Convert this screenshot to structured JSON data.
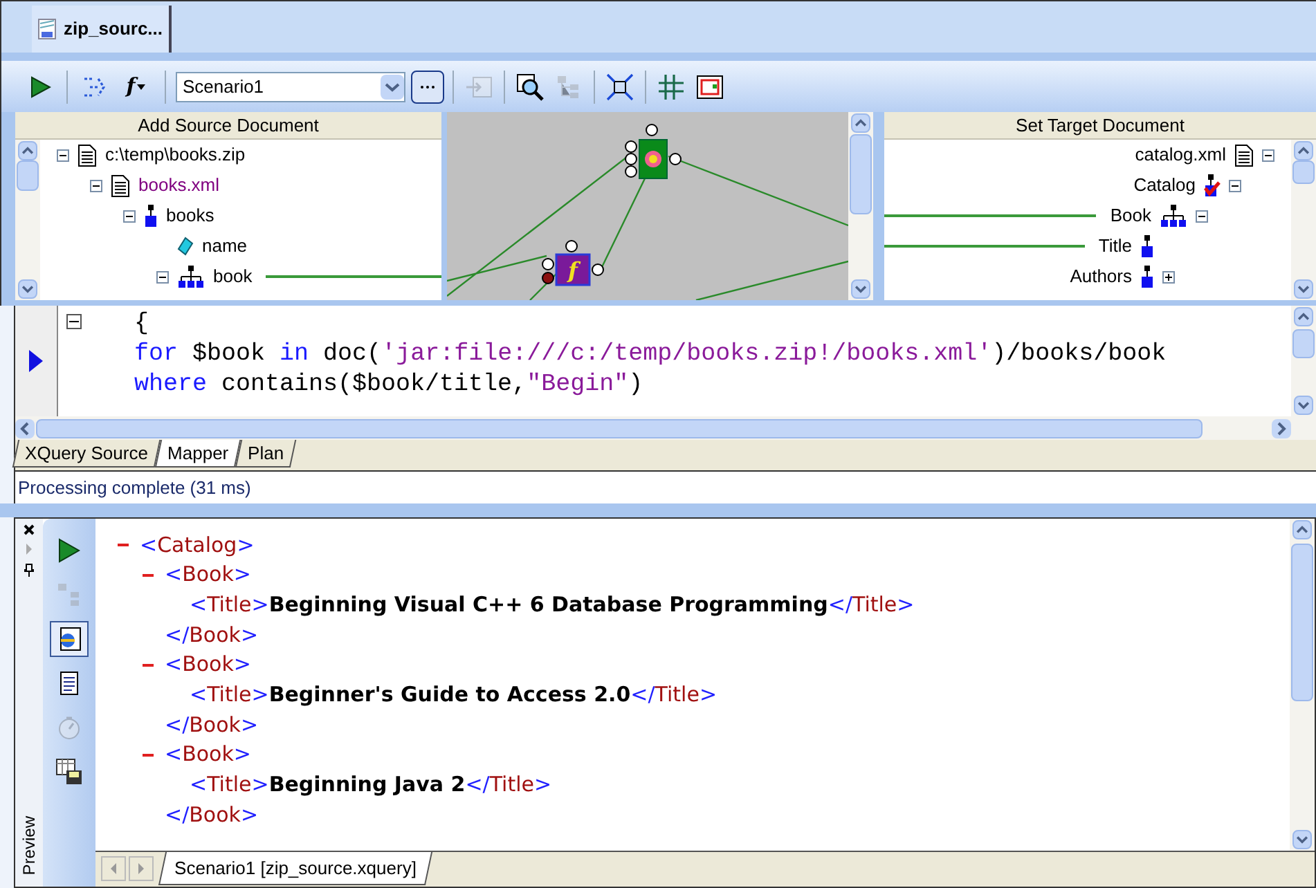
{
  "document_tabs": [
    {
      "label": "zip_sourc...",
      "selected": true
    }
  ],
  "toolbar": {
    "buttons_left": [
      {
        "kind": "run",
        "disabled": false
      },
      {
        "kind": "link",
        "disabled": false
      },
      {
        "kind": "function",
        "label": "f",
        "disabled": false
      }
    ],
    "scenario": "Scenario1",
    "buttons_right": [
      {
        "kind": "browse",
        "disabled": false
      },
      {
        "kind": "insert",
        "disabled": true
      },
      {
        "kind": "search",
        "disabled": false
      },
      {
        "kind": "tree",
        "disabled": true
      },
      {
        "kind": "shrink",
        "disabled": false
      },
      {
        "kind": "align",
        "disabled": false
      },
      {
        "kind": "frame",
        "disabled": false
      }
    ]
  },
  "source": {
    "header": "Add Source Document",
    "tree": [
      {
        "label": "c:\\temp\\books.zip",
        "kind": "file",
        "expanded": true,
        "children": [
          {
            "label": "books.xml",
            "kind": "xml",
            "expanded": true,
            "children": [
              {
                "label": "books",
                "kind": "element",
                "expanded": true,
                "children": [
                  {
                    "label": "name",
                    "kind": "attribute",
                    "mapped": false
                  },
                  {
                    "label": "book",
                    "kind": "repeating",
                    "expanded": true,
                    "mapped": true
                  }
                ]
              }
            ]
          }
        ]
      }
    ]
  },
  "canvas": {
    "nodes": [
      {
        "kind": "function",
        "label": "f"
      },
      {
        "kind": "flower"
      }
    ]
  },
  "target": {
    "header": "Set Target Document",
    "tree": [
      {
        "label": "catalog.xml",
        "kind": "file",
        "expanded": true,
        "children": [
          {
            "label": "Catalog",
            "kind": "root",
            "expanded": true,
            "children": [
              {
                "label": "Book",
                "kind": "repeating",
                "expanded": true,
                "mapped": true,
                "children": [
                  {
                    "label": "Title",
                    "kind": "element",
                    "mapped": true
                  },
                  {
                    "label": "Authors",
                    "kind": "element",
                    "expanded": false,
                    "mapped": false
                  }
                ]
              }
            ]
          }
        ]
      }
    ]
  },
  "code": [
    [
      {
        "kind": "plain",
        "text": "{"
      }
    ],
    [
      {
        "kind": "keyword",
        "text": "for"
      },
      {
        "kind": "plain",
        "text": " $book "
      },
      {
        "kind": "keyword",
        "text": "in"
      },
      {
        "kind": "plain",
        "text": " doc("
      },
      {
        "kind": "string",
        "text": "'jar:file:///c:/temp/books.zip!/books.xml'"
      },
      {
        "kind": "plain",
        "text": ")/books/book"
      }
    ],
    [
      {
        "kind": "keyword",
        "text": "where"
      },
      {
        "kind": "plain",
        "text": " contains($book/title,"
      },
      {
        "kind": "string",
        "text": "\"Begin\""
      },
      {
        "kind": "plain",
        "text": ")"
      }
    ]
  ],
  "view_tabs": [
    {
      "label": "XQuery Source",
      "selected": false
    },
    {
      "label": "Mapper",
      "selected": true
    },
    {
      "label": "Plan",
      "selected": false
    }
  ],
  "status": "Processing complete (31 ms)",
  "preview": {
    "label": "Preview",
    "tools": [
      {
        "kind": "run",
        "disabled": false,
        "pressed": false
      },
      {
        "kind": "tree",
        "disabled": true,
        "pressed": false
      },
      {
        "kind": "browser",
        "disabled": false,
        "pressed": true
      },
      {
        "kind": "text",
        "disabled": false,
        "pressed": false
      },
      {
        "kind": "timer",
        "disabled": true,
        "pressed": false
      },
      {
        "kind": "save",
        "disabled": false,
        "pressed": false
      }
    ],
    "xml": [
      {
        "open": "<Catalog>",
        "expanded": true,
        "children": [
          {
            "open": "<Book>",
            "close": "</Book>",
            "expanded": true,
            "children": [
              {
                "open": "<Title>",
                "text": "Beginning Visual C++ 6 Database Programming",
                "close": "</Title>"
              }
            ]
          },
          {
            "open": "<Book>",
            "close": "</Book>",
            "expanded": true,
            "children": [
              {
                "open": "<Title>",
                "text": "Beginner's Guide to Access 2.0",
                "close": "</Title>"
              }
            ]
          },
          {
            "open": "<Book>",
            "close": "</Book>",
            "expanded": true,
            "children": [
              {
                "open": "<Title>",
                "text": "Beginning Java 2",
                "close": "</Title>"
              }
            ]
          }
        ]
      }
    ],
    "tabs": [
      {
        "label": "Scenario1 [zip_source.xquery]",
        "selected": true
      }
    ]
  }
}
